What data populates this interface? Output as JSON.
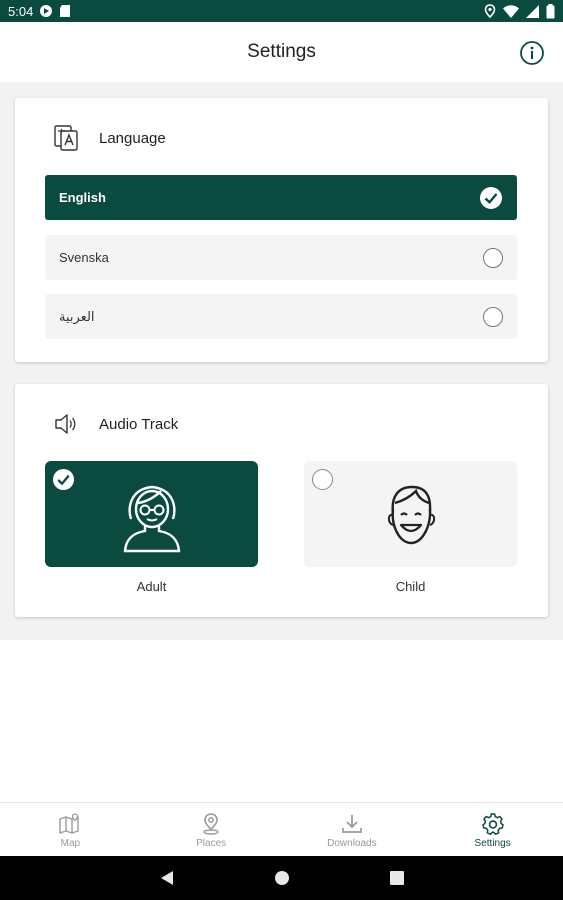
{
  "status_bar": {
    "time": "5:04"
  },
  "header": {
    "title": "Settings"
  },
  "language": {
    "heading": "Language",
    "options": [
      {
        "label": "English",
        "selected": true
      },
      {
        "label": "Svenska",
        "selected": false
      },
      {
        "label": "العربية",
        "selected": false
      }
    ]
  },
  "audio": {
    "heading": "Audio Track",
    "options": [
      {
        "label": "Adult",
        "selected": true
      },
      {
        "label": "Child",
        "selected": false
      }
    ]
  },
  "bottom_nav": {
    "items": [
      {
        "label": "Map",
        "icon": "map-icon",
        "active": false
      },
      {
        "label": "Places",
        "icon": "place-pin-icon",
        "active": false
      },
      {
        "label": "Downloads",
        "icon": "download-icon",
        "active": false
      },
      {
        "label": "Settings",
        "icon": "gear-icon",
        "active": true
      }
    ]
  },
  "colors": {
    "primary": "#0b4a3e",
    "inactive": "#9a9a9a",
    "background": "#f2f2f2"
  }
}
